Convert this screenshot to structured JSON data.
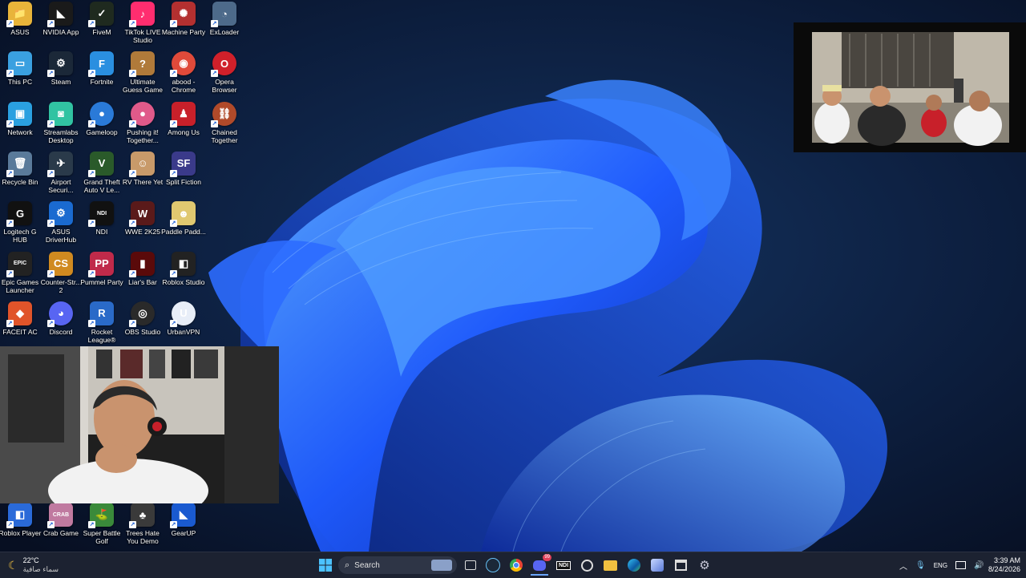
{
  "desktop": {
    "icons": [
      {
        "label": "ASUS",
        "glyph": "📁",
        "bg": "#e8b43a"
      },
      {
        "label": "NVIDIA App",
        "glyph": "◣",
        "bg": "#1a1a1a"
      },
      {
        "label": "FiveM",
        "glyph": "✓",
        "bg": "#1f2a1f"
      },
      {
        "label": "TikTok LIVE Studio",
        "glyph": "♪",
        "bg": "#ff2d6f"
      },
      {
        "label": "Machine Party",
        "glyph": "✺",
        "bg": "#b33030"
      },
      {
        "label": "ExLoader",
        "glyph": "◔",
        "bg": "#4d6a8a"
      },
      {
        "label": "This PC",
        "glyph": "▭",
        "bg": "#3aa0e0"
      },
      {
        "label": "Steam",
        "glyph": "⚙",
        "bg": "#1b2838"
      },
      {
        "label": "Fortnite",
        "glyph": "F",
        "bg": "#2a8fe0"
      },
      {
        "label": "Ultimate Guess Game",
        "glyph": "?",
        "bg": "#b07a3a"
      },
      {
        "label": "abood - Chrome",
        "glyph": "◉",
        "bg": "#e04a3a"
      },
      {
        "label": "Opera Browser",
        "glyph": "O",
        "bg": "#d0202a"
      },
      {
        "label": "Network",
        "glyph": "▣",
        "bg": "#2aa0e0"
      },
      {
        "label": "Streamlabs Desktop",
        "glyph": "◙",
        "bg": "#31c3a2"
      },
      {
        "label": "Gameloop",
        "glyph": "●",
        "bg": "#2a7ad8"
      },
      {
        "label": "Pushing it! Together...",
        "glyph": "●",
        "bg": "#e05a8a"
      },
      {
        "label": "Among Us",
        "glyph": "♟",
        "bg": "#c8202a"
      },
      {
        "label": "Chained Together",
        "glyph": "⛓",
        "bg": "#b04a2a"
      },
      {
        "label": "Recycle Bin",
        "glyph": "🗑",
        "bg": "#5a7a9a"
      },
      {
        "label": "Airport Securi...",
        "glyph": "✈",
        "bg": "#2a3a4a"
      },
      {
        "label": "Grand Theft Auto V Le...",
        "glyph": "V",
        "bg": "#2a5a2a"
      },
      {
        "label": "RV There Yet",
        "glyph": "☺",
        "bg": "#c89a6a"
      },
      {
        "label": "Split Fiction",
        "glyph": "SF",
        "bg": "#3a3a8a"
      },
      {
        "label": "",
        "glyph": "",
        "bg": "transparent"
      },
      {
        "label": "Logitech G HUB",
        "glyph": "G",
        "bg": "#111111"
      },
      {
        "label": "ASUS DriverHub",
        "glyph": "⚙",
        "bg": "#1a6ad0"
      },
      {
        "label": "NDI",
        "glyph": "NDI",
        "bg": "#111111"
      },
      {
        "label": "WWE 2K25",
        "glyph": "W",
        "bg": "#5a1a1a"
      },
      {
        "label": "Paddle Padd...",
        "glyph": "☻",
        "bg": "#e0c870"
      },
      {
        "label": "",
        "glyph": "",
        "bg": "transparent"
      },
      {
        "label": "Epic Games Launcher",
        "glyph": "EPIC",
        "bg": "#222222"
      },
      {
        "label": "Counter-Str... 2",
        "glyph": "CS",
        "bg": "#d08a20"
      },
      {
        "label": "Pummel Party",
        "glyph": "PP",
        "bg": "#c02a4a"
      },
      {
        "label": "Liar's Bar",
        "glyph": "▮",
        "bg": "#5a0a0a"
      },
      {
        "label": "Roblox Studio",
        "glyph": "◧",
        "bg": "#222222"
      },
      {
        "label": "",
        "glyph": "",
        "bg": "transparent"
      },
      {
        "label": "FACEIT AC",
        "glyph": "◆",
        "bg": "#e0542a"
      },
      {
        "label": "Discord",
        "glyph": "◕",
        "bg": "#5865f2"
      },
      {
        "label": "Rocket League®",
        "glyph": "R",
        "bg": "#2a6ac8"
      },
      {
        "label": "OBS Studio",
        "glyph": "◎",
        "bg": "#2a2a2a"
      },
      {
        "label": "UrbanVPN",
        "glyph": "U",
        "bg": "#e8eef8"
      },
      {
        "label": "",
        "glyph": "",
        "bg": "transparent"
      }
    ],
    "bottom_icons": [
      {
        "label": "Roblox Player",
        "glyph": "◧",
        "bg": "#2a6ad8"
      },
      {
        "label": "Crab Game",
        "glyph": "CRAB",
        "bg": "#c07aa0"
      },
      {
        "label": "Super Battle Golf",
        "glyph": "⛳",
        "bg": "#3a8a3a"
      },
      {
        "label": "Trees Hate You Demo",
        "glyph": "♣",
        "bg": "#3a3a3a"
      },
      {
        "label": "GearUP",
        "glyph": "◣",
        "bg": "#1a5ad0"
      }
    ]
  },
  "weather": {
    "temp": "22°C",
    "desc": "سماء صافية"
  },
  "taskbar": {
    "search_label": "Search",
    "apps": [
      "File Explorer",
      "Steam",
      "Chrome",
      "Discord",
      "NDI",
      "OBS",
      "Folder",
      "Edge",
      "Microsoft",
      "Store",
      "Settings"
    ],
    "badge": "99"
  },
  "tray": {
    "lang": "ENG",
    "time": "3:39 AM",
    "date": "8/24/2026"
  },
  "colors": {
    "wall_dark": "#081226",
    "bloom": "#1e5bff",
    "taskbar": "#1c2231"
  }
}
